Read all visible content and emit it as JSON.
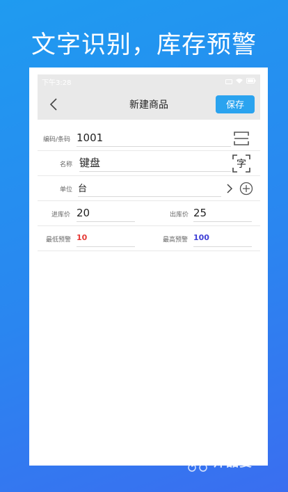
{
  "headline": "文字识别，库存预警",
  "statusbar": {
    "time": "下午3:28"
  },
  "appbar": {
    "title": "新建商品",
    "save_label": "保存"
  },
  "form": {
    "code_label": "编码/条码",
    "code_value": "1001",
    "name_label": "名称",
    "name_value": "键盘",
    "ocr_icon_text": "字",
    "unit_label": "单位",
    "unit_value": "台",
    "in_price_label": "进库价",
    "in_price_value": "20",
    "out_price_label": "出库价",
    "out_price_value": "25",
    "min_label": "最低预警",
    "min_value": "10",
    "max_label": "最高预警",
    "max_value": "100"
  },
  "watermark": "师品耍",
  "colors": {
    "accent": "#2aa3ef",
    "min_warning": "#e53935",
    "max_warning": "#3f3fd6"
  }
}
